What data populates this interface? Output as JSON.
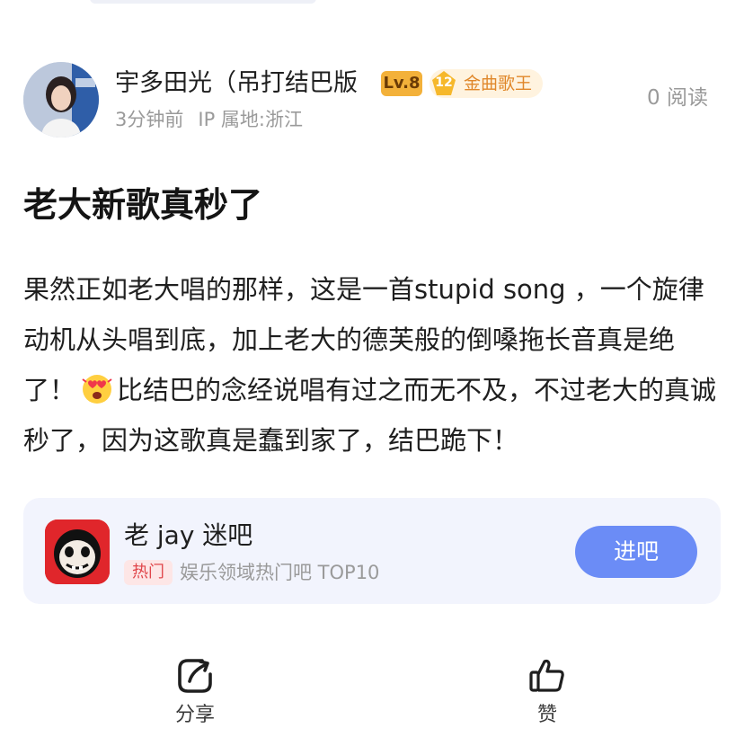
{
  "author": {
    "name": "宇多田光（吊打结巴版",
    "level": "Lv.8",
    "honor_level": "12",
    "honor_title": "金曲歌王",
    "time": "3分钟前",
    "ip": "IP 属地:浙江",
    "reads": "0 阅读"
  },
  "post": {
    "title": "老大新歌真秒了",
    "body_before_emoji": "果然正如老大唱的那样，这是一首stupid song ，一个旋律动机从头唱到底，加上老大的德芙般的倒嗓拖长音真是绝了！",
    "body_after_emoji": "比结巴的念经说唱有过之而无不及，不过老大的真诚秒了，因为这歌真是蠢到家了，结巴跪下！"
  },
  "forum": {
    "name": "老 jay 迷吧",
    "hot_tag": "热门",
    "desc": "娱乐领域热门吧 TOP10",
    "enter_label": "进吧"
  },
  "actions": {
    "share_label": "分享",
    "like_label": "赞"
  },
  "colors": {
    "accent": "#6b8cf6",
    "level_badge": "#f3b13a",
    "hot_tag": "#e0454a",
    "card_bg": "#f2f4fd"
  },
  "icons": {
    "share": "share-icon",
    "like": "thumbs-up-icon",
    "emoji": "heart-eyes-emoji-icon"
  }
}
